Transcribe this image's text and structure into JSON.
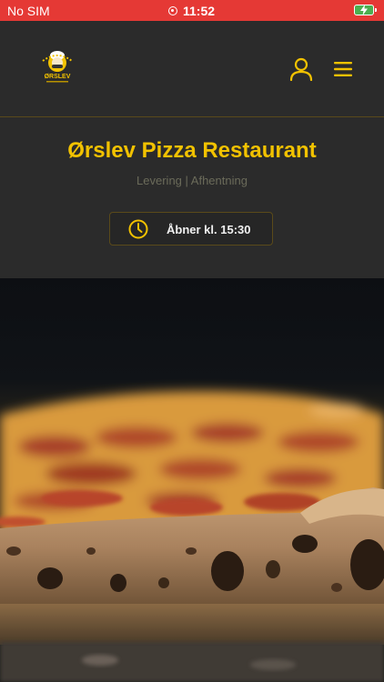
{
  "status_bar": {
    "carrier": "No SIM",
    "time": "11:52",
    "recording_icon": "recording-dot-icon",
    "battery_icon": "battery-charging-icon",
    "battery_color": "#4caf50",
    "bar_color": "#e53935"
  },
  "header": {
    "logo_text": "ØRSLEV",
    "user_icon": "user-icon",
    "menu_icon": "hamburger-menu-icon",
    "accent": "#f2c200"
  },
  "restaurant": {
    "name": "Ørslev Pizza Restaurant",
    "services": "Levering | Afhentning",
    "opening": {
      "icon": "clock-icon",
      "label": "Åbner kl. 15:30"
    }
  },
  "hero": {
    "image_subject": "pizza-photo"
  }
}
